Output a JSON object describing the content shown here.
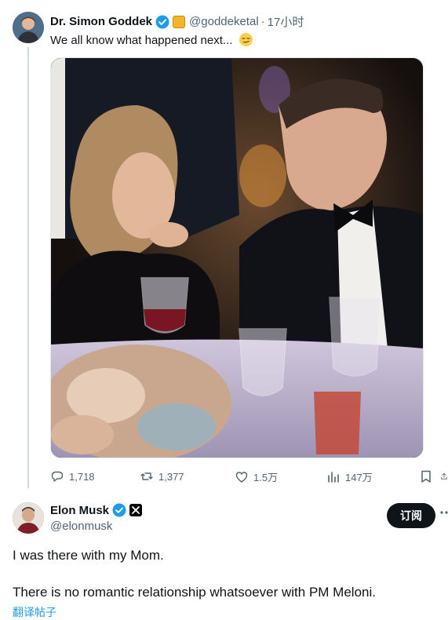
{
  "tweet1": {
    "author_name": "Dr. Simon Goddek",
    "handle": "@goddeketal",
    "separator": "·",
    "time": "17小时",
    "text": "We all know what happened next...",
    "emoji": "smirk-emoji",
    "actions": {
      "reply_count": "1,718",
      "retweet_count": "1,377",
      "like_count": "1.5万",
      "view_count": "147万"
    }
  },
  "tweet2": {
    "author_name": "Elon Musk",
    "handle": "@elonmusk",
    "subscribe_label": "订阅",
    "line1": "I was there with my Mom.",
    "line2": "There is no romantic relationship whatsoever with PM Meloni.",
    "translate_label": "翻译帖子"
  },
  "icons": [
    "verified-badge-icon",
    "gold-badge-icon",
    "reply-icon",
    "retweet-icon",
    "like-icon",
    "views-icon",
    "bookmark-icon",
    "share-icon",
    "x-badge-icon",
    "more-icon"
  ],
  "colors": {
    "verified": "#1d9bf0",
    "link": "#1d9bf0",
    "secondary_text": "#536471",
    "primary_text": "#0f1419",
    "button_bg": "#0f1419"
  }
}
